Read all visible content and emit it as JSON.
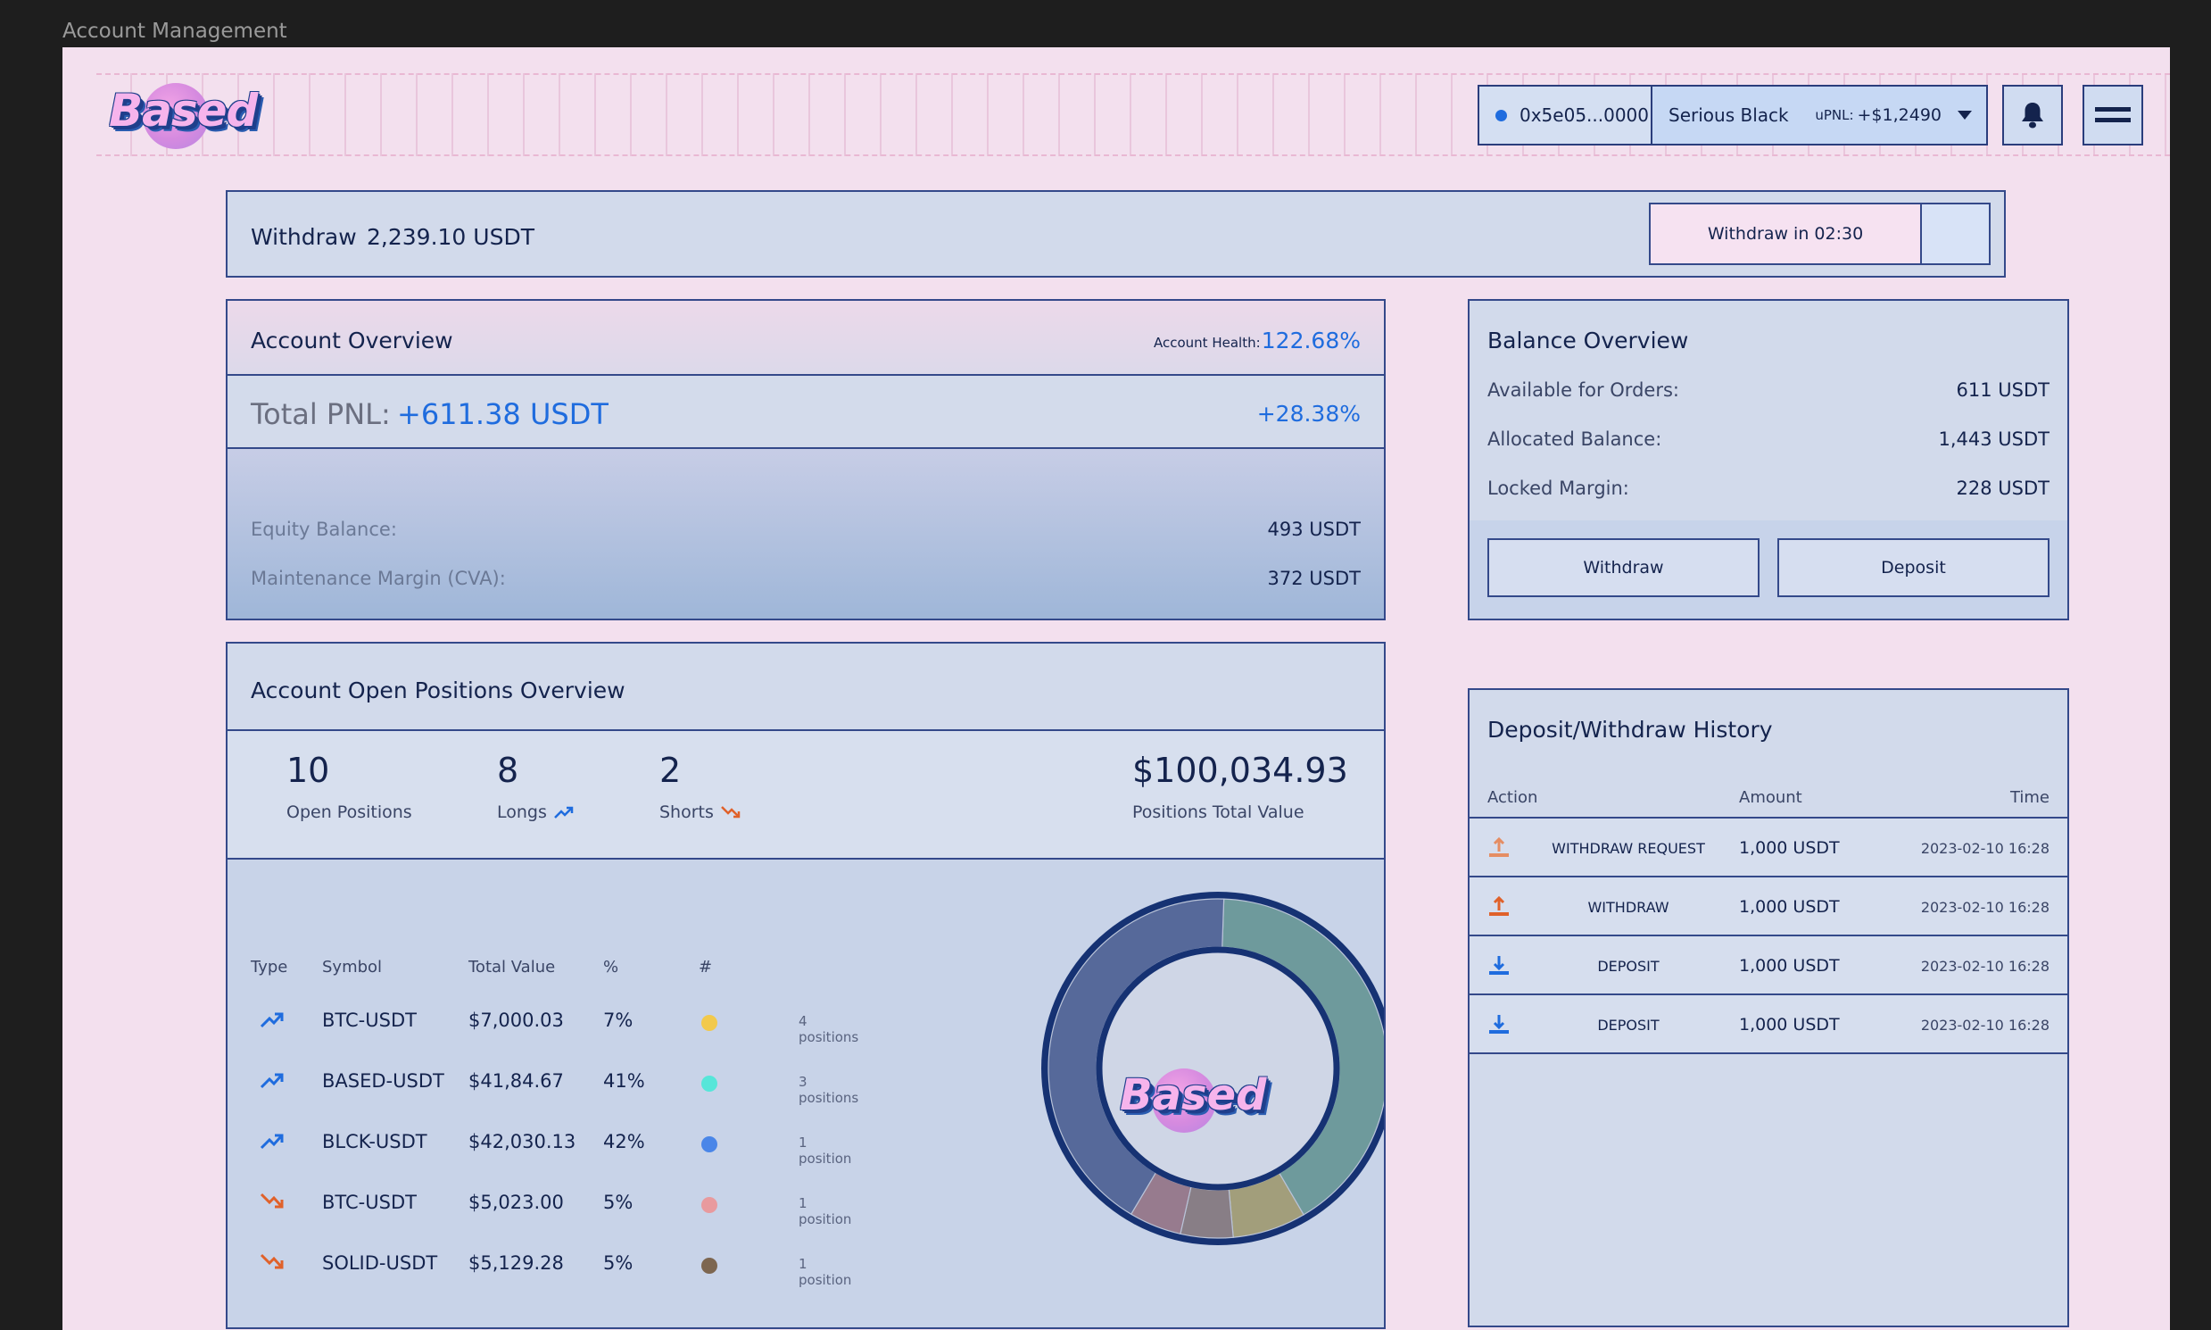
{
  "frame_label": "Account Management",
  "logo_text": "Based",
  "wallet": {
    "address": "0x5e05...0000",
    "account_name": "Serious Black",
    "upnl_label": "uPNL:",
    "upnl_value": "+$1,2490"
  },
  "withdraw_bar": {
    "label": "Withdraw",
    "amount": "2,239.10 USDT",
    "timer_label": "Withdraw in 02:30"
  },
  "account_overview": {
    "title": "Account Overview",
    "health_label": "Account Health:",
    "health_value": "122.68%",
    "pnl_label": "Total PNL:",
    "pnl_value": "+611.38 USDT",
    "pnl_percent": "+28.38%",
    "equity_label": "Equity Balance:",
    "equity_value": "493 USDT",
    "margin_label": "Maintenance Margin (CVA):",
    "margin_value": "372 USDT"
  },
  "balance_overview": {
    "title": "Balance Overview",
    "rows": [
      {
        "label": "Available for Orders:",
        "value": "611 USDT"
      },
      {
        "label": "Allocated Balance:",
        "value": "1,443 USDT"
      },
      {
        "label": "Locked Margin:",
        "value": "228 USDT"
      }
    ],
    "withdraw_button": "Withdraw",
    "deposit_button": "Deposit"
  },
  "positions": {
    "title": "Account Open Positions Overview",
    "stats": {
      "open_count": "10",
      "open_label": "Open Positions",
      "longs_count": "8",
      "longs_label": "Longs",
      "shorts_count": "2",
      "shorts_label": "Shorts",
      "total_value": "$100,034.93",
      "total_label": "Positions Total Value"
    },
    "columns": [
      "Type",
      "Symbol",
      "Total Value",
      "%",
      "#"
    ],
    "rows": [
      {
        "type": "long",
        "symbol": "BTC-USDT",
        "value": "$7,000.03",
        "percent": "7%",
        "count": "4 positions",
        "color": "#f2c94c"
      },
      {
        "type": "long",
        "symbol": "BASED-USDT",
        "value": "$41,84.67",
        "percent": "41%",
        "count": "3 positions",
        "color": "#56e6d9"
      },
      {
        "type": "long",
        "symbol": "BLCK-USDT",
        "value": "$42,030.13",
        "percent": "42%",
        "count": "1 position",
        "color": "#4a86e8"
      },
      {
        "type": "short",
        "symbol": "BTC-USDT",
        "value": "$5,023.00",
        "percent": "5%",
        "count": "1 position",
        "color": "#e89a9e"
      },
      {
        "type": "short",
        "symbol": "SOLID-USDT",
        "value": "$5,129.28",
        "percent": "5%",
        "count": "1 position",
        "color": "#7d6650"
      }
    ]
  },
  "chart_data": {
    "type": "pie",
    "categories": [
      "BTC-USDT",
      "BASED-USDT",
      "BLCK-USDT",
      "BTC-USDT",
      "SOLID-USDT"
    ],
    "values": [
      7,
      41,
      42,
      5,
      5
    ],
    "colors": [
      "#a29e7b",
      "#6e9a9c",
      "#56699a",
      "#887e86",
      "#977b8e"
    ]
  },
  "history": {
    "title": "Deposit/Withdraw History",
    "columns": {
      "action": "Action",
      "amount": "Amount",
      "time": "Time"
    },
    "rows": [
      {
        "action": "WITHDRAW REQUEST",
        "kind": "withdraw-request",
        "amount": "1,000 USDT",
        "time": "2023-02-10 16:28"
      },
      {
        "action": "WITHDRAW",
        "kind": "withdraw",
        "amount": "1,000 USDT",
        "time": "2023-02-10 16:28"
      },
      {
        "action": "DEPOSIT",
        "kind": "deposit",
        "amount": "1,000 USDT",
        "time": "2023-02-10 16:28"
      },
      {
        "action": "DEPOSIT",
        "kind": "deposit",
        "amount": "1,000 USDT",
        "time": "2023-02-10 16:28"
      }
    ]
  }
}
